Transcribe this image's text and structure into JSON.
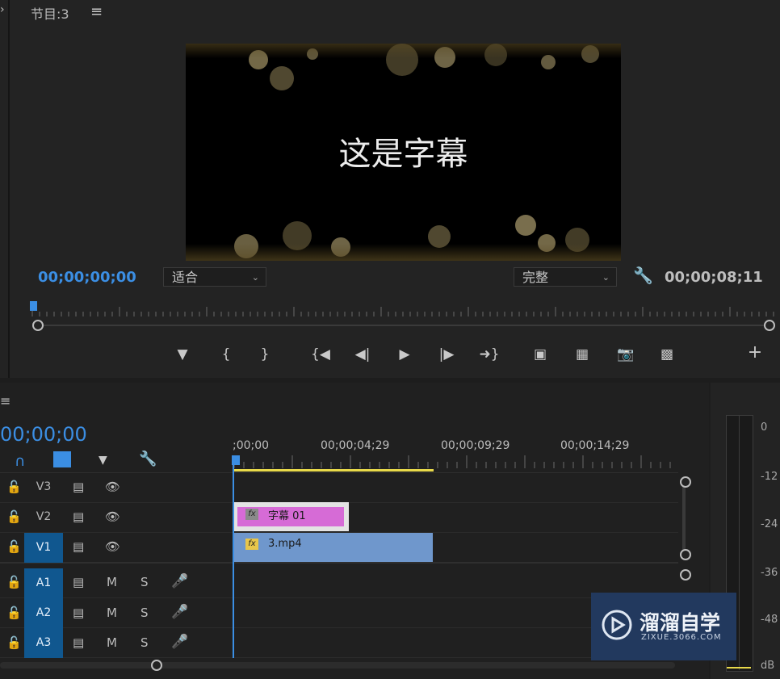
{
  "monitor": {
    "title": "节目:3",
    "menu_icon": "hamburger-icon",
    "caption": "这是字幕",
    "current_timecode": "00;00;00;00",
    "zoom_select": "适合",
    "quality_select": "完整",
    "duration_timecode": "00;00;08;11",
    "controls": {
      "add_marker": "marker-icon",
      "mark_in": "mark-in-icon",
      "mark_out": "mark-out-icon",
      "go_to_in": "go-to-in-icon",
      "step_back": "step-back-icon",
      "play": "play-icon",
      "step_forward": "step-forward-icon",
      "go_to_out": "go-to-out-icon",
      "lift": "lift-icon",
      "extract": "extract-icon",
      "export_frame": "camera-icon",
      "compare": "compare-icon",
      "add_button": "+"
    }
  },
  "timeline": {
    "current_timecode": "00;00;00",
    "ruler_labels": [
      ";00;00",
      "00;00;04;29",
      "00;00;09;29",
      "00;00;14;29"
    ],
    "tracks": [
      {
        "id": "V3",
        "type": "video",
        "active": false
      },
      {
        "id": "V2",
        "type": "video",
        "active": false
      },
      {
        "id": "V1",
        "type": "video",
        "active": true
      },
      {
        "id": "A1",
        "type": "audio",
        "active": true
      },
      {
        "id": "A2",
        "type": "audio",
        "active": true
      },
      {
        "id": "A3",
        "type": "audio",
        "active": true
      }
    ],
    "audio_mute_label": "M",
    "audio_solo_label": "S",
    "clips": {
      "title_clip": "字幕 01",
      "video_clip": "3.mp4",
      "fx_label": "fx"
    }
  },
  "meter": {
    "scale": [
      "0",
      "-12",
      "-24",
      "-36",
      "-48",
      "dB"
    ]
  },
  "watermark": {
    "brand": "溜溜自学",
    "url": "ZIXUE.3066.COM"
  }
}
